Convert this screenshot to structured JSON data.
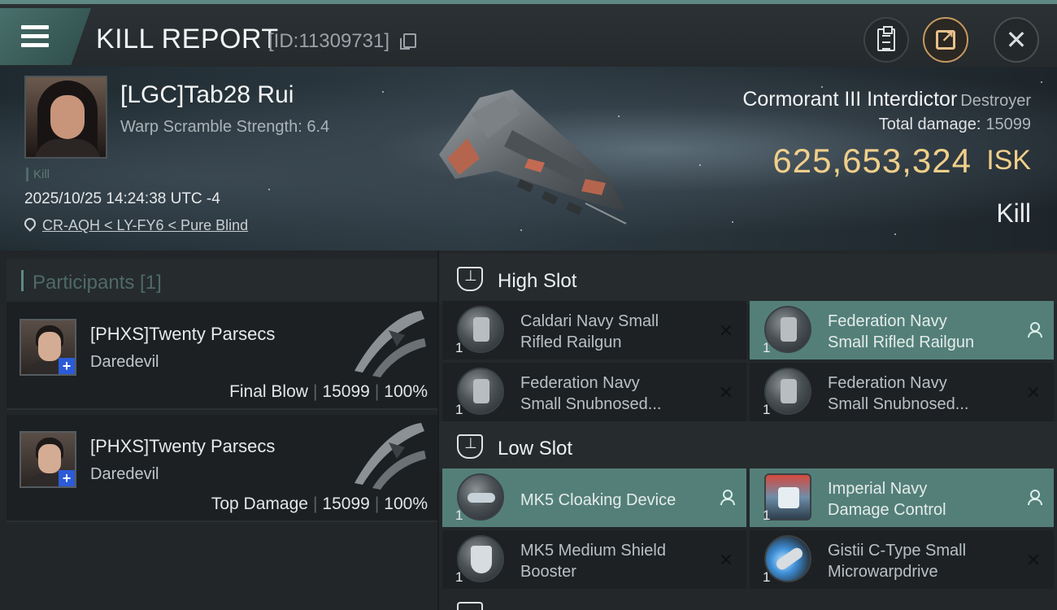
{
  "header": {
    "title": "KILL REPORT",
    "kill_id": "[ID:11309731]",
    "icons": [
      "menu-icon",
      "copy-icon",
      "clipboard-icon",
      "share-icon",
      "close-icon"
    ]
  },
  "victim": {
    "name": "[LGC]Tab28 Rui",
    "warp_scramble": "Warp Scramble Strength: 6.4",
    "tag": "Kill",
    "timestamp": "2025/10/25 14:24:38 UTC -4",
    "location": "CR-AQH < LY-FY6 < Pure Blind",
    "ship_name": "Cormorant III Interdictor",
    "ship_class": "Destroyer",
    "total_damage_label": "Total damage:",
    "total_damage": "15099",
    "isk_value": "625,653,324",
    "isk_unit": "ISK",
    "result": "Kill"
  },
  "participants": {
    "header": "Participants [1]",
    "rows": [
      {
        "name": "[PHXS]Twenty Parsecs",
        "ship": "Daredevil",
        "role": "Final Blow",
        "damage": "15099",
        "percent": "100%"
      },
      {
        "name": "[PHXS]Twenty Parsecs",
        "ship": "Daredevil",
        "role": "Top Damage",
        "damage": "15099",
        "percent": "100%"
      }
    ]
  },
  "fitting": {
    "high_slot": {
      "title": "High Slot",
      "modules": [
        {
          "qty": "1",
          "line1": "Caldari Navy Small",
          "line2": "Rifled Railgun",
          "state": "destroyed"
        },
        {
          "qty": "1",
          "line1": "Federation Navy",
          "line2": "Small Rifled Railgun",
          "state": "dropped"
        },
        {
          "qty": "1",
          "line1": "Federation Navy",
          "line2": "Small Snubnosed...",
          "state": "destroyed"
        },
        {
          "qty": "1",
          "line1": "Federation Navy",
          "line2": "Small Snubnosed...",
          "state": "destroyed"
        }
      ]
    },
    "low_slot": {
      "title": "Low Slot",
      "modules": [
        {
          "qty": "1",
          "line1": "MK5 Cloaking Device",
          "line2": "",
          "state": "dropped"
        },
        {
          "qty": "1",
          "line1": "Imperial Navy",
          "line2": "Damage Control",
          "state": "dropped"
        },
        {
          "qty": "1",
          "line1": "MK5 Medium Shield",
          "line2": "Booster",
          "state": "destroyed"
        },
        {
          "qty": "1",
          "line1": "Gistii C-Type Small",
          "line2": "Microwarpdrive",
          "state": "destroyed"
        }
      ]
    },
    "status_glyphs": {
      "destroyed": "✕",
      "dropped": "person-icon"
    }
  },
  "colors": {
    "accent": "#5f8a84",
    "isk_gold": "#f0cf8a",
    "dropped_bg": "#547f79",
    "destroyed_bg": "#1d2124"
  }
}
